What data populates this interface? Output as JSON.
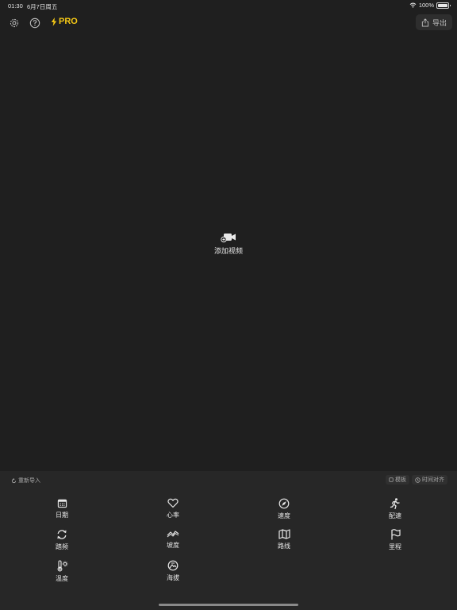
{
  "status_bar": {
    "time": "01:30",
    "date": "6月7日周五",
    "battery": "100%"
  },
  "toolbar": {
    "pro_label": "PRO",
    "export_label": "导出"
  },
  "main": {
    "add_video_label": "添加视频"
  },
  "panel": {
    "reimport_label": "重新导入",
    "template_label": "模板",
    "time_align_label": "时间对齐",
    "items": [
      {
        "label": "日期",
        "icon": "calendar-icon"
      },
      {
        "label": "心率",
        "icon": "heart-icon"
      },
      {
        "label": "速度",
        "icon": "compass-icon"
      },
      {
        "label": "配速",
        "icon": "runner-icon"
      },
      {
        "label": "踏频",
        "icon": "cycle-icon"
      },
      {
        "label": "坡度",
        "icon": "slope-icon"
      },
      {
        "label": "路线",
        "icon": "map-icon"
      },
      {
        "label": "里程",
        "icon": "flag-icon"
      },
      {
        "label": "温度",
        "icon": "thermometer-icon"
      },
      {
        "label": "海拔",
        "icon": "altitude-icon"
      }
    ]
  },
  "colors": {
    "background": "#1f1f1f",
    "panel": "#272727",
    "pro_accent": "#f6c915"
  }
}
